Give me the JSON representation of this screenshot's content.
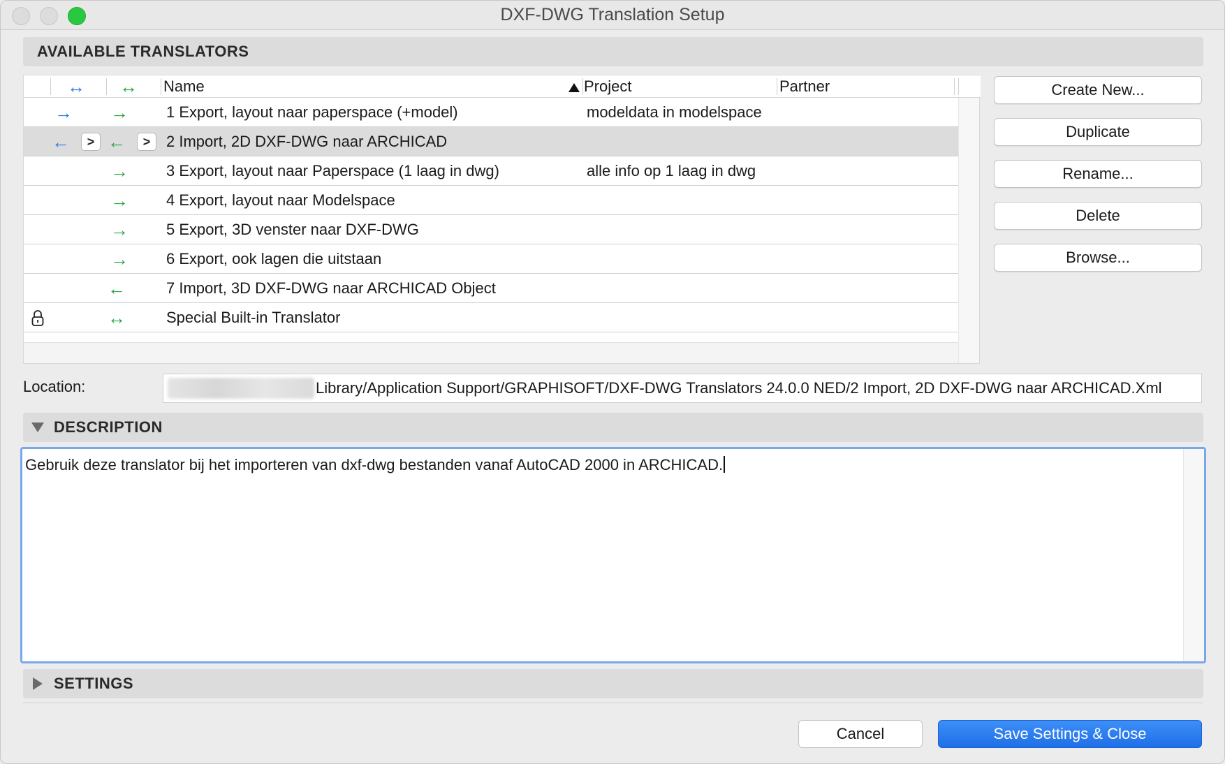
{
  "window": {
    "title": "DXF-DWG Translation Setup"
  },
  "sections": {
    "available_translators": "AVAILABLE TRANSLATORS",
    "description": "DESCRIPTION",
    "settings": "SETTINGS"
  },
  "table": {
    "columns": {
      "col1_icon": "↔",
      "col2_icon": "↔",
      "name": "Name",
      "project": "Project",
      "partner": "Partner"
    },
    "rows": [
      {
        "a1": "→",
        "a2": "→",
        "name": "1 Export, layout naar paperspace (+model)",
        "project": "modeldata in modelspace",
        "partner": ""
      },
      {
        "a1": "←",
        "a2": "←",
        "name": "2 Import, 2D DXF-DWG naar ARCHICAD",
        "project": "",
        "partner": "",
        "selected": true
      },
      {
        "a1": "",
        "a2": "→",
        "name": "3 Export, layout naar Paperspace (1 laag in dwg)",
        "project": "alle info op 1 laag in dwg",
        "partner": ""
      },
      {
        "a1": "",
        "a2": "→",
        "name": "4 Export, layout naar Modelspace",
        "project": "",
        "partner": ""
      },
      {
        "a1": "",
        "a2": "→",
        "name": "5 Export, 3D venster naar DXF-DWG",
        "project": "",
        "partner": ""
      },
      {
        "a1": "",
        "a2": "→",
        "name": "6 Export, ook lagen die uitstaan",
        "project": "",
        "partner": ""
      },
      {
        "a1": "",
        "a2": "←",
        "name": "7 Import, 3D DXF-DWG naar ARCHICAD Object",
        "project": "",
        "partner": ""
      },
      {
        "a1": "",
        "a2": "↔",
        "name": "Special Built-in Translator",
        "project": "",
        "partner": "",
        "locked": true
      }
    ]
  },
  "side_buttons": {
    "create_new": "Create New...",
    "duplicate": "Duplicate",
    "rename": "Rename...",
    "delete": "Delete",
    "browse": "Browse..."
  },
  "location": {
    "label": "Location:",
    "path": "Library/Application Support/GRAPHISOFT/DXF-DWG Translators 24.0.0 NED/2 Import, 2D DXF-DWG naar ARCHICAD.Xml"
  },
  "description_text": "Gebruik deze translator bij het importeren van dxf-dwg bestanden vanaf AutoCAD 2000 in ARCHICAD.",
  "footer": {
    "cancel": "Cancel",
    "save": "Save Settings & Close"
  },
  "colors": {
    "accent_blue": "#2f7ae5",
    "arrow_green": "#27a844",
    "save_button": "#1f6fe8",
    "focus_ring": "#7aa7ea"
  }
}
